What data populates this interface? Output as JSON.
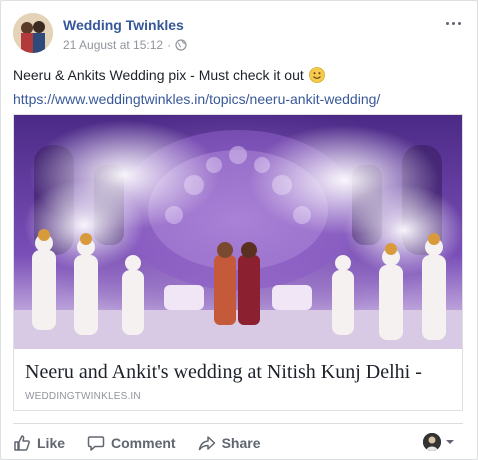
{
  "post": {
    "author": "Wedding Twinkles",
    "timestamp": "21 August at 15:12",
    "separator": "·",
    "privacy_icon": "globe-icon",
    "text": "Neeru & Ankits Wedding pix - Must check it out",
    "emoji": "smiley-emoji",
    "link": "https://www.weddingtwinkles.in/topics/neeru-ankit-wedding/"
  },
  "link_card": {
    "title": "Neeru and Ankit's wedding at Nitish Kunj Delhi -",
    "domain": "WEDDINGTWINKLES.IN"
  },
  "actions": {
    "like": "Like",
    "comment": "Comment",
    "share": "Share"
  },
  "colors": {
    "author_blue": "#365899",
    "link_blue": "#385898",
    "muted": "#90949c",
    "action_gray": "#606770"
  }
}
